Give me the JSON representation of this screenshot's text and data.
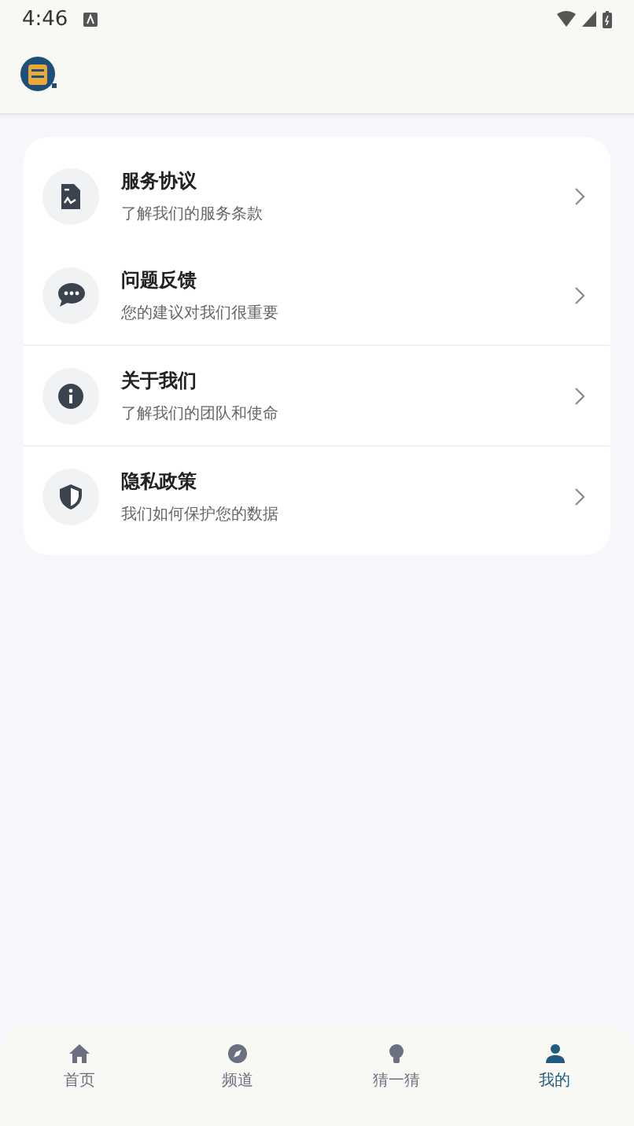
{
  "status_bar": {
    "time": "4:46"
  },
  "menu": [
    {
      "title": "服务协议",
      "subtitle": "了解我们的服务条款"
    },
    {
      "title": "问题反馈",
      "subtitle": "您的建议对我们很重要"
    },
    {
      "title": "关于我们",
      "subtitle": "了解我们的团队和使命"
    },
    {
      "title": "隐私政策",
      "subtitle": "我们如何保护您的数据"
    }
  ],
  "bottom_nav": [
    {
      "label": "首页",
      "selected": false
    },
    {
      "label": "频道",
      "selected": false
    },
    {
      "label": "猜一猜",
      "selected": false
    },
    {
      "label": "我的",
      "selected": true
    }
  ]
}
